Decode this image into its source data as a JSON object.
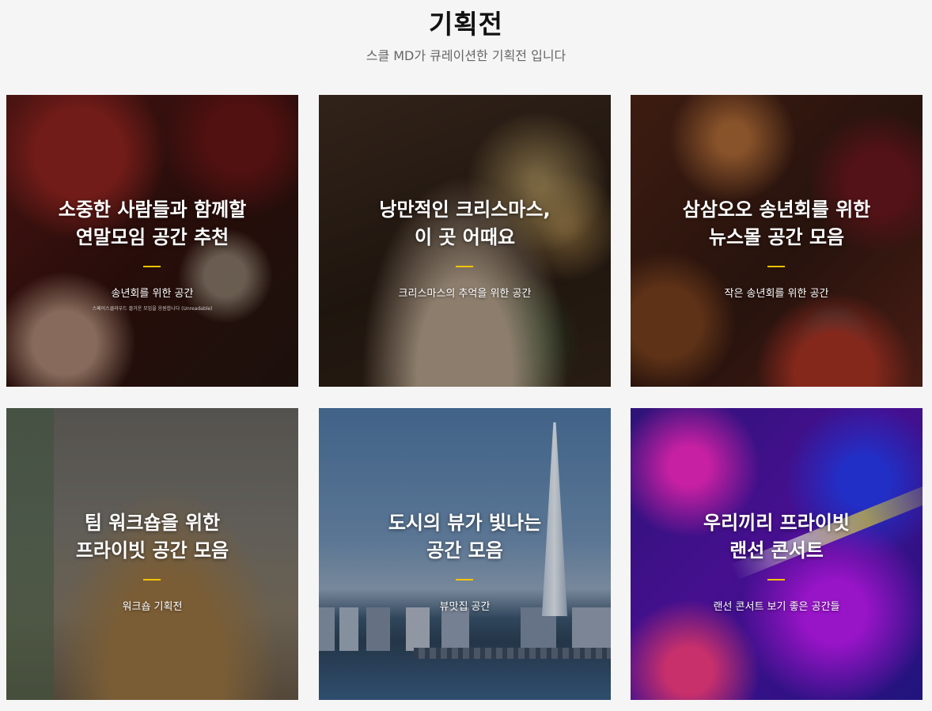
{
  "header": {
    "title": "기획전",
    "subtitle": "스클 MD가 큐레이션한 기획전 입니다"
  },
  "cards": [
    {
      "title_line1": "소중한 사람들과 함께할",
      "title_line2": "연말모임 공간 추천",
      "subtitle": "송년회를 위한 공간",
      "note": "스페이스클라우드 즐거운 모임을 응원합니다 (Unreadable)"
    },
    {
      "title_line1": "낭만적인 크리스마스,",
      "title_line2": "이 곳 어때요",
      "subtitle": "크리스마스의 추억을 위한 공간"
    },
    {
      "title_line1": "삼삼오오 송년회를 위한",
      "title_line2": "뉴스몰 공간 모음",
      "subtitle": "작은 송년회를 위한 공간"
    },
    {
      "title_line1": "팀 워크숍을 위한",
      "title_line2": "프라이빗 공간 모음",
      "subtitle": "워크숍 기획전"
    },
    {
      "title_line1": "도시의 뷰가 빛나는",
      "title_line2": "공간 모음",
      "subtitle": "뷰맛집 공간"
    },
    {
      "title_line1": "우리끼리 프라이빗",
      "title_line2": "랜선 콘서트",
      "subtitle": "랜선 콘서트 보기 좋은 공간들"
    }
  ],
  "colors": {
    "accent_bar": "#f5c400",
    "background": "#f5f5f5"
  }
}
